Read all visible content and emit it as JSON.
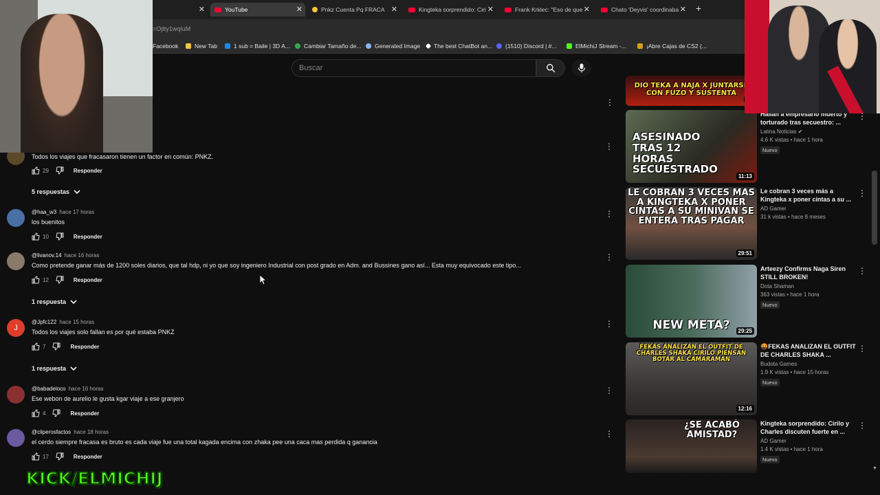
{
  "browser": {
    "tabs": [
      {
        "label": "",
        "icon": "youtube-icon"
      },
      {
        "label": "YouTube",
        "icon": "youtube-icon"
      },
      {
        "label": "Pnkz Cuenta Pq FRACA",
        "icon": "emoji-icon"
      },
      {
        "label": "Kingteka sorprendido: Ciri",
        "icon": "youtube-icon"
      },
      {
        "label": "Frank Krklec: \"Eso de que",
        "icon": "youtube-icon"
      },
      {
        "label": "Chato 'Deyvis' coordinaba",
        "icon": "youtube-icon"
      }
    ],
    "new_tab": "+",
    "url_fragment": "=Ojtty1wqIuM",
    "bookmarks": [
      {
        "label": "Facebook",
        "color": "#2b2b2b"
      },
      {
        "label": "New Tab",
        "color": "#f4c542"
      },
      {
        "label": "1 sub = Baile | 3D A...",
        "color": "#1e88e5"
      },
      {
        "label": "Cambiar Tamaño de...",
        "color": "#34a853"
      },
      {
        "label": "Generated Image",
        "color": "#8ab4f8"
      },
      {
        "label": "The best ChatBot an...",
        "color": "#ffffff"
      },
      {
        "label": "(1510) Discord | #...",
        "color": "#5865f2"
      },
      {
        "label": "ElMichiJ Stream -...",
        "color": "#53fc18"
      },
      {
        "label": "¡Abre Cajas de CS2 (...",
        "color": "#d4a017"
      }
    ]
  },
  "header": {
    "search_placeholder": "Buscar"
  },
  "comments": [
    {
      "author": "",
      "time": "",
      "text": "Todos los viajes que fracasaron tienen un factor en común: PNKZ.",
      "likes": "29",
      "reply_label": "Responder",
      "avatar_color": "#5a4a2a",
      "replies": "5 respuestas"
    },
    {
      "author": "@haa_w3",
      "time": "hace 17 horas",
      "text": "los buenitos",
      "likes": "10",
      "reply_label": "Responder",
      "avatar_color": "#4a6fa5",
      "replies": ""
    },
    {
      "author": "@livanov.14",
      "time": "hace 16 horas",
      "text": "Como pretende ganar más de 1200 soles diarios, que tal hdp, ni yo que soy ingeniero Industrial con post grado en Adm. and Bussines gano así... Esta muy equivocado este tipo...",
      "likes": "12",
      "reply_label": "Responder",
      "avatar_color": "#8a7a6a",
      "replies": "1 respuesta"
    },
    {
      "author": "@Jpfc122",
      "time": "hace 15 horas",
      "text": "Todos los viajes solo fallan es por qué estaba PNKZ",
      "likes": "7",
      "reply_label": "Responder",
      "avatar_color": "#e03c2a",
      "avatar_letter": "J",
      "replies": "1 respuesta"
    },
    {
      "author": "@babadeloco",
      "time": "hace 16 horas",
      "text": "Ese webon de aurelio le gusta kgar viaje a ese granjero",
      "likes": "4",
      "reply_label": "Responder",
      "avatar_color": "#8a3030",
      "replies": ""
    },
    {
      "author": "@cliperosfactos",
      "time": "hace 18 horas",
      "text": "el cerdo siempre fracasa es bruto es cada viaje fue una total kagada encima con zhaka pee una caca mas perdida q ganancia",
      "likes": "17",
      "reply_label": "Responder",
      "avatar_color": "#6a5aa0",
      "replies": ""
    }
  ],
  "sidebar": {
    "videos": [
      {
        "thumb_caption": "DIO TEKA A NAJA X JUNTARSE CON FUZO Y SUSTENTA",
        "duration": "27",
        "title": "",
        "channel": "",
        "stats": "",
        "new": ""
      },
      {
        "thumb_caption": "ASESINADO TRAS 12 HORAS SECUESTRADO",
        "duration": "11:13",
        "title": "Hallan a empresario muerto y torturado tras secuestro: ...",
        "channel": "Latina Noticias",
        "stats": "4.6 K vistas • hace 1 hora",
        "new": "Nuevo"
      },
      {
        "thumb_caption": "LE COBRAN 3 VECES MAS A KINGTEKA X PONER CINTAS A SU MINIVAN SE ENTERA TRAS PAGAR",
        "duration": "29:51",
        "title": "Le cobran 3 veces más a Kingteka x poner cintas a su ...",
        "channel": "AD Gamer",
        "stats": "31 k vistas • hace 8 meses",
        "new": ""
      },
      {
        "thumb_caption": "NEW META?",
        "duration": "29:25",
        "title": "Arteezy Confirms Naga Siren STILL BROKEN!",
        "channel": "Dota Shaman",
        "stats": "363 vistas • hace 1 hora",
        "new": "Nuevo"
      },
      {
        "thumb_caption": "FEKAS ANALIZAN EL OUTFIT DE CHARLES SHAKA CIRILO PIENSAN BOTAR AL CAMARAMAN",
        "duration": "12:16",
        "title": "🤬FEKAS ANALIZAN EL OUTFIT DE CHARLES SHAKA ...",
        "channel": "Budota Games",
        "stats": "1.9 K vistas • hace 15 horas",
        "new": "Nuevo"
      },
      {
        "thumb_caption": "¿SE ACABÓ AMISTAD?",
        "duration": "",
        "title": "Kingteka sorprendido: Cirilo y Charles discuten fuerte en ...",
        "channel": "AD Gamer",
        "stats": "1.4 K vistas • hace 1 hora",
        "new": "Nuevo"
      }
    ]
  },
  "overlay": {
    "kick_label": "KICK/ELMICHIJ"
  },
  "colors": {
    "background": "#0f0f0f",
    "accent_kick": "#53fc18",
    "youtube_red": "#ff0033"
  }
}
